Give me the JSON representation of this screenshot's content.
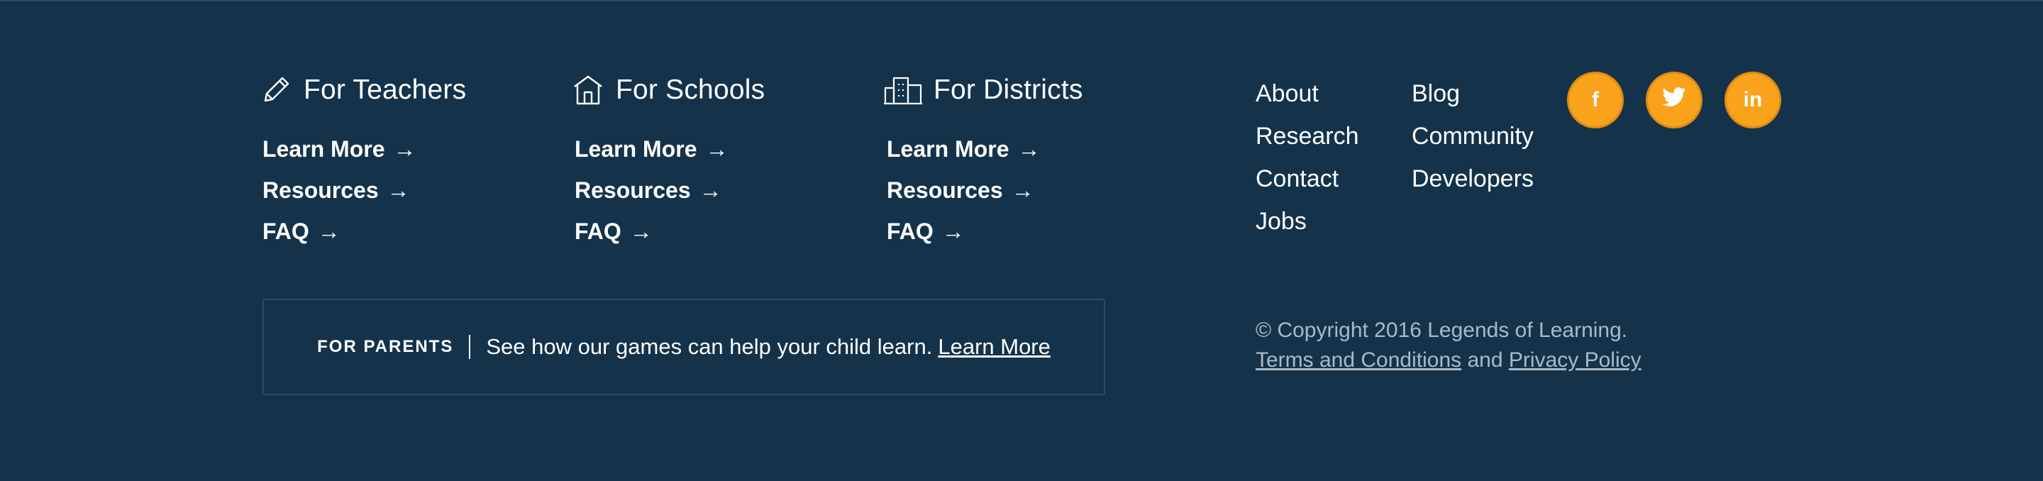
{
  "columns": [
    {
      "title": "For Teachers",
      "icon": "pencil-icon",
      "links": [
        "Learn More",
        "Resources",
        "FAQ"
      ]
    },
    {
      "title": "For Schools",
      "icon": "school-house-icon",
      "links": [
        "Learn More",
        "Resources",
        "FAQ"
      ]
    },
    {
      "title": "For Districts",
      "icon": "city-buildings-icon",
      "links": [
        "Learn More",
        "Resources",
        "FAQ"
      ]
    }
  ],
  "arrow": "→",
  "parents": {
    "label": "FOR PARENTS",
    "text": "See how our games can help your child learn.",
    "link": "Learn More"
  },
  "nav": {
    "col1": [
      "About",
      "Research",
      "Contact",
      "Jobs"
    ],
    "col2": [
      "Blog",
      "Community",
      "Developers"
    ]
  },
  "social": [
    {
      "name": "facebook-icon",
      "glyph": "f"
    },
    {
      "name": "twitter-icon",
      "glyph": "t"
    },
    {
      "name": "linkedin-icon",
      "glyph": "in"
    }
  ],
  "footer": {
    "copyright": "© Copyright 2016 Legends of Learning.",
    "terms": "Terms and Conditions",
    "and": "and",
    "privacy": "Privacy Policy"
  },
  "colors": {
    "background": "#14334a",
    "accent": "#f9a21b",
    "muted_text": "#a9b9c6"
  }
}
